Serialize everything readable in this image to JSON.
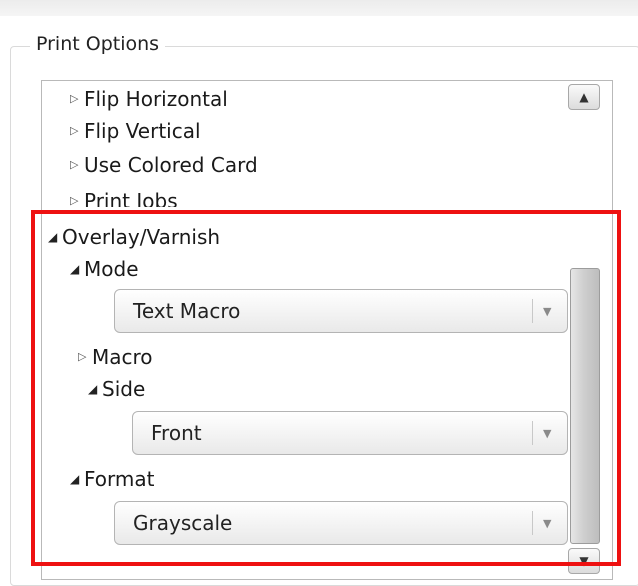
{
  "group": {
    "title": "Print Options"
  },
  "tree": {
    "flip_horizontal": "Flip Horizontal",
    "flip_vertical": "Flip Vertical",
    "use_colored_card": "Use Colored Card",
    "print_jobs": "Print Jobs",
    "overlay_varnish": "Overlay/Varnish",
    "mode": {
      "label": "Mode",
      "value": "Text Macro"
    },
    "macro": "Macro",
    "side": {
      "label": "Side",
      "value": "Front"
    },
    "format": {
      "label": "Format",
      "value": "Grayscale"
    }
  },
  "icons": {
    "collapsed": "triangle-right-icon",
    "expanded": "triangle-down-icon",
    "dropdown": "chevron-down-icon",
    "scroll_up": "scroll-up-arrow-icon",
    "scroll_down": "scroll-down-arrow-icon"
  },
  "colors": {
    "highlight": "#ee1111"
  }
}
